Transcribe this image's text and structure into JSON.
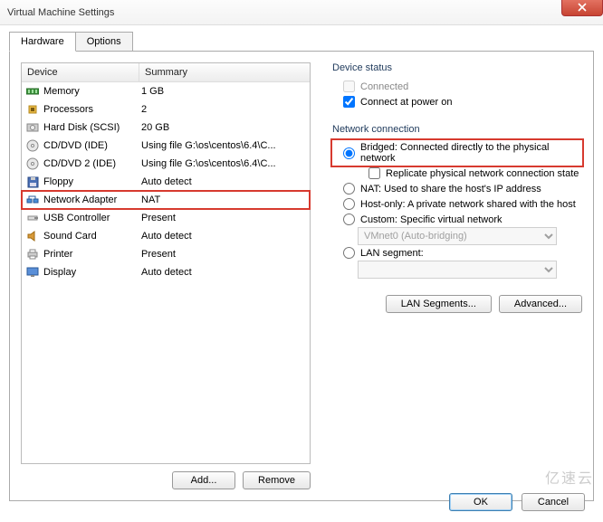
{
  "window": {
    "title": "Virtual Machine Settings"
  },
  "tabs": {
    "hardware": "Hardware",
    "options": "Options"
  },
  "headers": {
    "device": "Device",
    "summary": "Summary"
  },
  "devices": [
    {
      "name": "Memory",
      "summary": "1 GB"
    },
    {
      "name": "Processors",
      "summary": "2"
    },
    {
      "name": "Hard Disk (SCSI)",
      "summary": "20 GB"
    },
    {
      "name": "CD/DVD (IDE)",
      "summary": "Using file G:\\os\\centos\\6.4\\C..."
    },
    {
      "name": "CD/DVD 2 (IDE)",
      "summary": "Using file G:\\os\\centos\\6.4\\C..."
    },
    {
      "name": "Floppy",
      "summary": "Auto detect"
    },
    {
      "name": "Network Adapter",
      "summary": "NAT"
    },
    {
      "name": "USB Controller",
      "summary": "Present"
    },
    {
      "name": "Sound Card",
      "summary": "Auto detect"
    },
    {
      "name": "Printer",
      "summary": "Present"
    },
    {
      "name": "Display",
      "summary": "Auto detect"
    }
  ],
  "buttons": {
    "add": "Add...",
    "remove": "Remove",
    "ok": "OK",
    "cancel": "Cancel",
    "lanseg": "LAN Segments...",
    "advanced": "Advanced..."
  },
  "status": {
    "title": "Device status",
    "connected": "Connected",
    "connected_checked": false,
    "powerOn": "Connect at power on",
    "powerOn_checked": true
  },
  "net": {
    "title": "Network connection",
    "bridged": "Bridged: Connected directly to the physical network",
    "replicate": "Replicate physical network connection state",
    "nat": "NAT: Used to share the host's IP address",
    "hostonly": "Host-only: A private network shared with the host",
    "custom": "Custom: Specific virtual network",
    "vmnet": "VMnet0 (Auto-bridging)",
    "lan": "LAN segment:",
    "selected": "bridged"
  },
  "watermark": "亿速云"
}
